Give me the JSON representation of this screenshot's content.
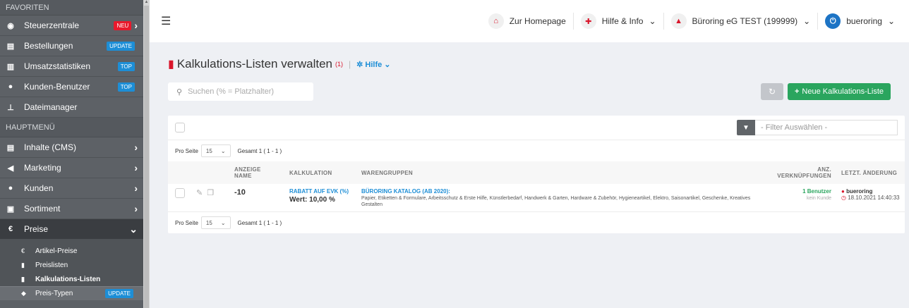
{
  "sidebar": {
    "section_fav": "FAVORITEN",
    "section_main": "HAUPTMENÜ",
    "fav_items": [
      {
        "label": "Steuerzentrale",
        "badge": "NEU",
        "badge_color": "#e8192c",
        "icon": "dashboard-icon"
      },
      {
        "label": "Bestellungen",
        "badge": "UPDATE",
        "badge_color": "#1d8ed6",
        "icon": "document-icon"
      },
      {
        "label": "Umsatzstatistiken",
        "badge": "TOP",
        "badge_color": "#1d8ed6",
        "icon": "chart-icon"
      },
      {
        "label": "Kunden-Benutzer",
        "badge": "TOP",
        "badge_color": "#1d8ed6",
        "icon": "user-icon"
      },
      {
        "label": "Dateimanager",
        "badge": "",
        "icon": "sitemap-icon"
      }
    ],
    "main_items": [
      {
        "label": "Inhalte (CMS)",
        "icon": "document-icon"
      },
      {
        "label": "Marketing",
        "icon": "megaphone-icon"
      },
      {
        "label": "Kunden",
        "icon": "users-icon"
      },
      {
        "label": "Sortiment",
        "icon": "cart-icon"
      },
      {
        "label": "Preise",
        "icon": "euro-icon"
      }
    ],
    "sub_items": [
      {
        "label": "Artikel-Preise",
        "icon": "euro-icon"
      },
      {
        "label": "Preislisten",
        "icon": "document-icon"
      },
      {
        "label": "Kalkulations-Listen",
        "icon": "document-icon"
      },
      {
        "label": "Preis-Typen",
        "icon": "tag-icon",
        "badge": "UPDATE"
      }
    ]
  },
  "topbar": {
    "homepage": "Zur Homepage",
    "help": "Hilfe & Info",
    "company": "Büroring eG TEST (199999)",
    "user": "bueroring"
  },
  "main": {
    "title": "Kalkulations-Listen verwalten",
    "count": "(1)",
    "help": "Hilfe",
    "search_placeholder": "Suchen (% = Platzhalter)",
    "new_button": "Neue Kalkulations-Liste",
    "filter_placeholder": "- Filter Auswählen -",
    "per_page_label": "Pro Seite",
    "per_page_value": "15",
    "total": "Gesamt 1 ( 1 - 1 )",
    "columns": {
      "name_1": "ANZEIGE",
      "name_2": "NAME",
      "kalk": "KALKULATION",
      "war": "WARENGRUPPEN",
      "ver_1": "ANZ.",
      "ver_2": "VERKNÜPFUNGEN",
      "date": "LETZT. ÄNDERUNG"
    },
    "row": {
      "name": "-10",
      "kalk_type": "RABATT AUF EVK (%)",
      "kalk_value": "Wert: 10,00 %",
      "war_title": "BÜRORING KATALOG (AB 2020):",
      "war_text": "Papier, Etiketten & Formulare, Arbeitsschutz & Erste Hilfe, Künstlerbedarf, Handwerk & Garten, Hardware & Zubehör, Hygieneartikel, Elektro, Saisonartikel, Geschenke, Kreatives Gestalten",
      "links": "1 Benutzer",
      "links_sub": "kein Kunde",
      "changed_by": "bueroring",
      "changed_at": "18.10.2021 14:40:33"
    }
  }
}
